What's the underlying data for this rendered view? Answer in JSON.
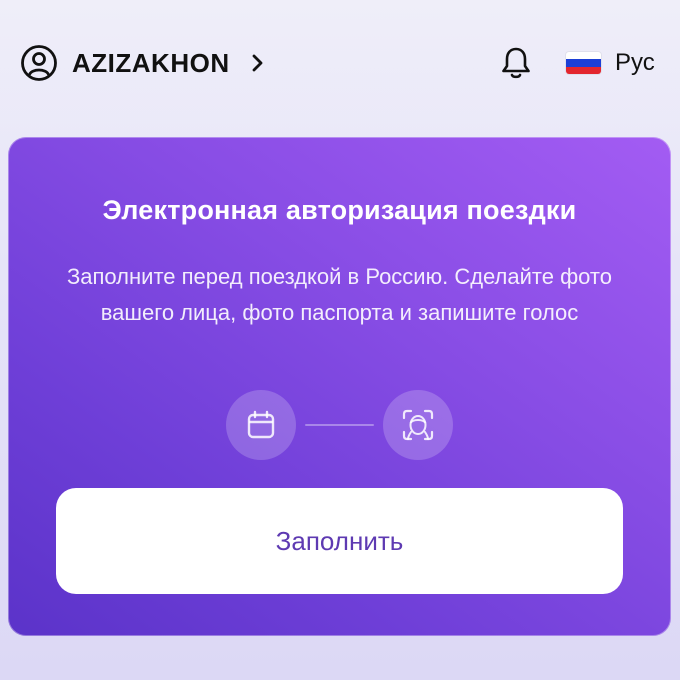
{
  "header": {
    "username": "AZIZAKHON",
    "language_label": "Рус",
    "flag_colors": [
      "#ffffff",
      "#1c3fd6",
      "#e3262e"
    ]
  },
  "card": {
    "title": "Электронная авторизация поездки",
    "description": "Заполните перед поездкой в Россию. Сделайте фото вашего лица, фото паспорта и запишите голос",
    "steps": [
      {
        "icon": "calendar-icon"
      },
      {
        "icon": "face-scan-icon"
      }
    ],
    "button_label": "Заполнить",
    "colors": {
      "gradient_start": "#a35cf3",
      "gradient_end": "#5b33c9",
      "button_text": "#5e3ab2"
    }
  }
}
